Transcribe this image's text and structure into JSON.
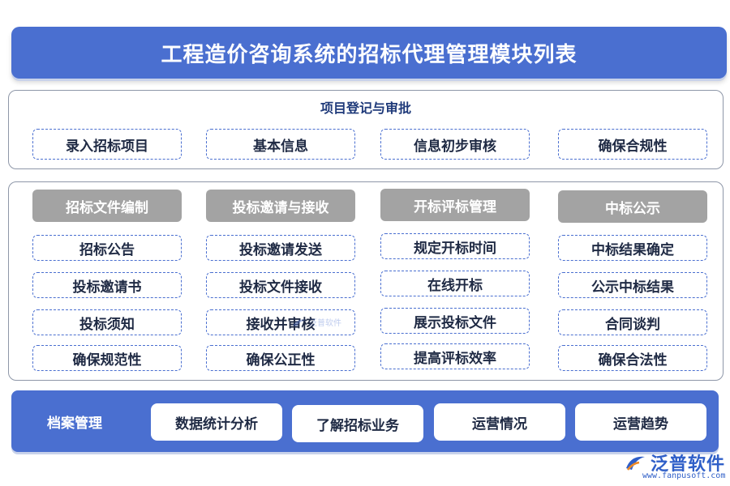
{
  "title": "工程造价咨询系统的招标代理管理模块列表",
  "registration": {
    "heading": "项目登记与审批",
    "items": [
      "录入招标项目",
      "基本信息",
      "信息初步审核",
      "确保合规性"
    ]
  },
  "columns": [
    {
      "heading": "招标文件编制",
      "items": [
        "招标公告",
        "投标邀请书",
        "投标须知",
        "确保规范性"
      ]
    },
    {
      "heading": "投标邀请与接收",
      "items": [
        "投标邀请发送",
        "投标文件接收",
        "接收并审核",
        "确保公正性"
      ]
    },
    {
      "heading": "开标评标管理",
      "items": [
        "规定开标时间",
        "在线开标",
        "展示投标文件",
        "提高评标效率"
      ]
    },
    {
      "heading": "中标公示",
      "items": [
        "中标结果确定",
        "公示中标结果",
        "合同谈判",
        "确保合法性"
      ]
    }
  ],
  "archive": {
    "label": "档案管理",
    "items": [
      "数据统计分析",
      "了解招标业务",
      "运营情况",
      "运营趋势"
    ]
  },
  "watermark": "泛普软件",
  "logo": {
    "name": "泛普软件",
    "url": "www.fanpusoft.com",
    "icon": "fanpu-logo-icon"
  },
  "colors": {
    "accent": "#4a6fd0",
    "header_gray": "#a3a3a3",
    "text": "#1f2a44"
  }
}
